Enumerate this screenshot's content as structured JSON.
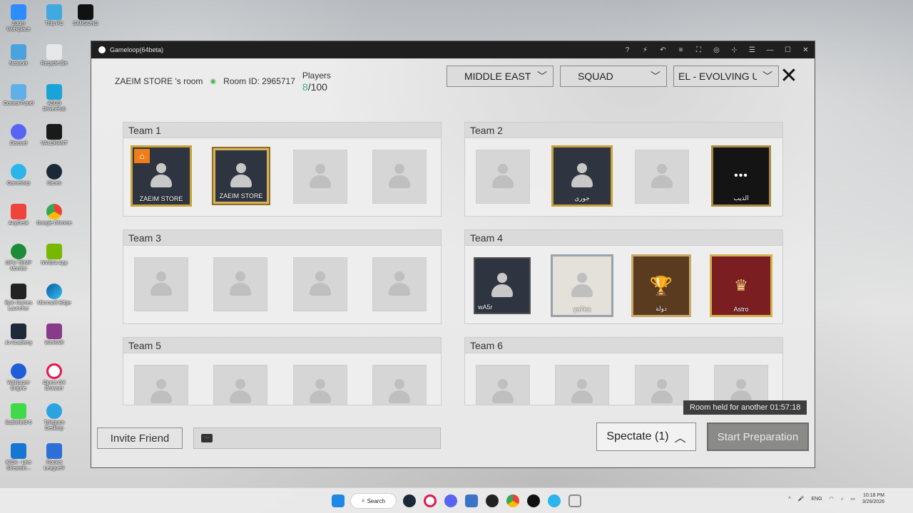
{
  "window": {
    "title": "Gameloop(64beta)"
  },
  "room": {
    "owner_text": "ZAEIM  STORE  's room",
    "room_id": "Room ID: 2965717",
    "players_label": "Players",
    "players_current": "8",
    "players_total": "/100"
  },
  "filters": {
    "region": "MIDDLE EAST",
    "mode": "SQUAD",
    "map": "EL - EVOLVING UNIVE"
  },
  "teams": [
    {
      "label": "Team 1",
      "slots": [
        {
          "state": "owner",
          "name": "ZAEIM STORE"
        },
        {
          "state": "gold",
          "name": "ZAEIM STORE"
        },
        {
          "state": "empty",
          "name": ""
        },
        {
          "state": "empty",
          "name": ""
        }
      ]
    },
    {
      "label": "Team 2",
      "slots": [
        {
          "state": "empty",
          "name": ""
        },
        {
          "state": "gold",
          "name": "جوري"
        },
        {
          "state": "empty",
          "name": ""
        },
        {
          "state": "dark",
          "name": "الذيب"
        }
      ]
    },
    {
      "label": "Team 3",
      "slots": [
        {
          "state": "empty",
          "name": ""
        },
        {
          "state": "empty",
          "name": ""
        },
        {
          "state": "empty",
          "name": ""
        },
        {
          "state": "empty",
          "name": ""
        }
      ]
    },
    {
      "label": "Team 4",
      "slots": [
        {
          "state": "plain",
          "name": "wA5r"
        },
        {
          "state": "photo",
          "name": "ya7ea"
        },
        {
          "state": "trophy",
          "name": "دولة"
        },
        {
          "state": "crown",
          "name": "Astro"
        }
      ]
    },
    {
      "label": "Team 5",
      "slots": [
        {
          "state": "empty",
          "name": ""
        },
        {
          "state": "empty",
          "name": ""
        },
        {
          "state": "empty",
          "name": ""
        },
        {
          "state": "empty",
          "name": ""
        }
      ]
    },
    {
      "label": "Team 6",
      "slots": [
        {
          "state": "empty",
          "name": ""
        },
        {
          "state": "empty",
          "name": ""
        },
        {
          "state": "empty",
          "name": ""
        },
        {
          "state": "empty",
          "name": ""
        }
      ]
    }
  ],
  "bottom": {
    "invite_label": "Invite Friend",
    "spectate_label": "Spectate (1)",
    "room_held": "Room held for another 01:57:18",
    "start_label": "Start Preparation"
  },
  "desktop_icons": [
    "Zoom Workplace",
    "This PC",
    "SAMSUNG",
    "Network",
    "Recycle Bin",
    "Control Panel",
    "ASUS DriverHub",
    "Discord",
    "VALORANT",
    "Gameloop",
    "Steam",
    "AnyDesk",
    "Google Chrome",
    "GPU TEMP Monitor",
    "NVIDIA App",
    "Epic Games Launcher",
    "Microsoft Edge",
    "Jo Academy",
    "WinRAR",
    "Wallpaper Engine",
    "Opera GX Browser",
    "Battlefield 6",
    "Telegram Desktop",
    "KICK - Live Streamin...",
    "Rocket League®"
  ],
  "taskbar": {
    "search_label": "Search",
    "lang": "ENG",
    "time": "10:18 PM",
    "date": "3/26/2026"
  }
}
